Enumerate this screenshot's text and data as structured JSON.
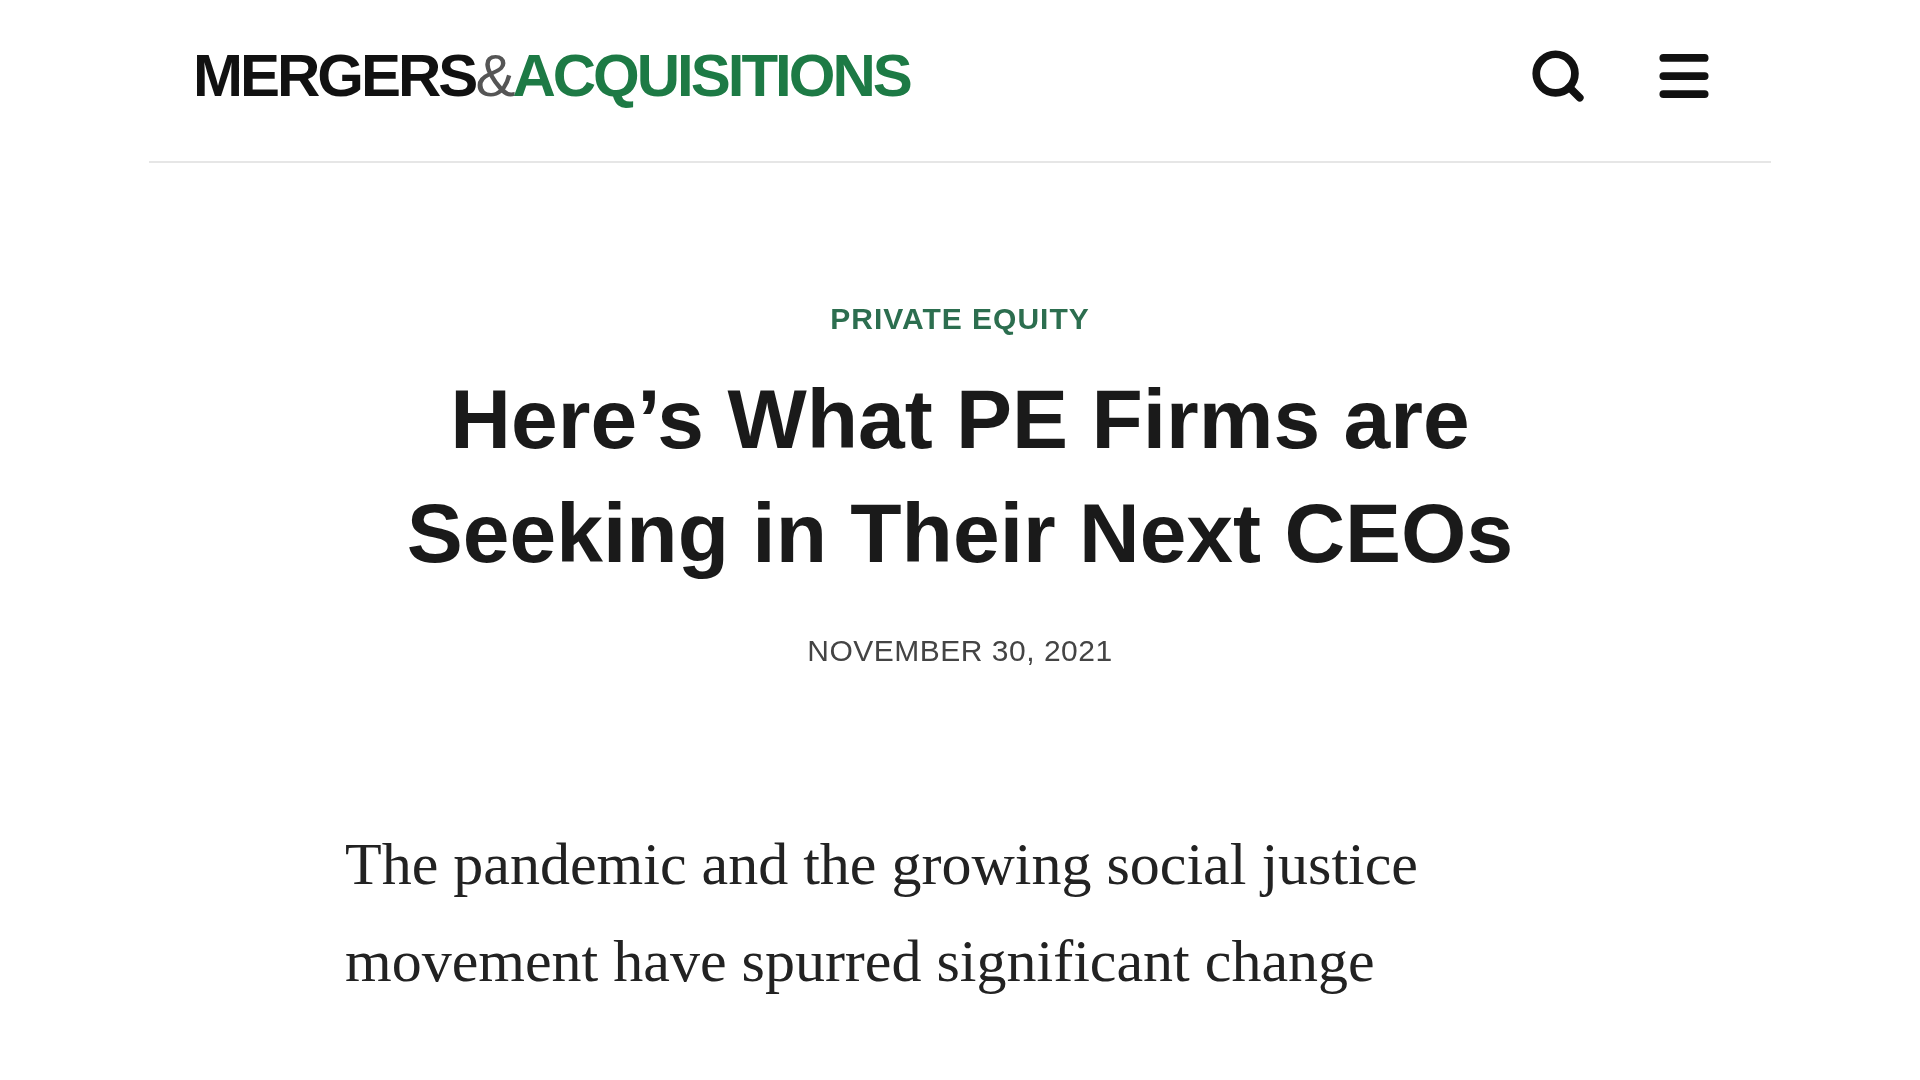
{
  "header": {
    "logo": {
      "first": "MERGERS",
      "ampersand": "&",
      "second": "ACQUISITIONS"
    }
  },
  "article": {
    "category": "PRIVATE EQUITY",
    "title": "Here’s What PE Firms are Seeking in Their Next CEOs",
    "date": "NOVEMBER 30, 2021",
    "body": "The pandemic and the growing social justice movement have spurred significant change"
  }
}
